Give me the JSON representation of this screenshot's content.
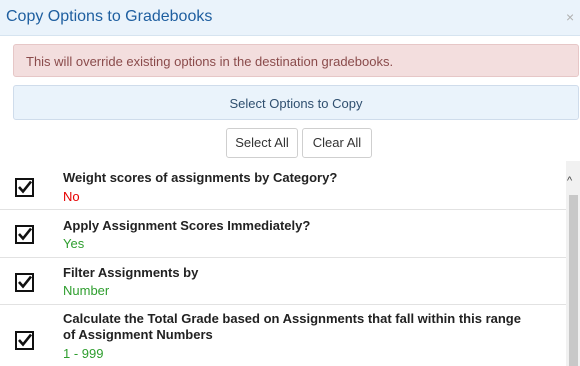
{
  "dialog": {
    "title": "Copy Options to Gradebooks",
    "close_icon": "×",
    "warning": "This will override existing options in the destination gradebooks.",
    "section_header": "Select Options to Copy"
  },
  "buttons": {
    "select_all": "Select All",
    "clear_all": "Clear All"
  },
  "colors": {
    "no_value": "#e60000",
    "yes_value": "#2e9e2e"
  },
  "options": [
    {
      "label": "Weight scores of assignments by Category?",
      "value": "No",
      "checked": true
    },
    {
      "label": "Apply Assignment Scores Immediately?",
      "value": "Yes",
      "checked": true
    },
    {
      "label": "Filter Assignments by",
      "value": "Number",
      "checked": true
    },
    {
      "label_line1": "Calculate the Total Grade based on Assignments that fall within this range",
      "label_line2": "of Assignment Numbers",
      "value": "1 - 999",
      "checked": true
    }
  ],
  "scrollbar": {
    "up_icon": "^"
  }
}
